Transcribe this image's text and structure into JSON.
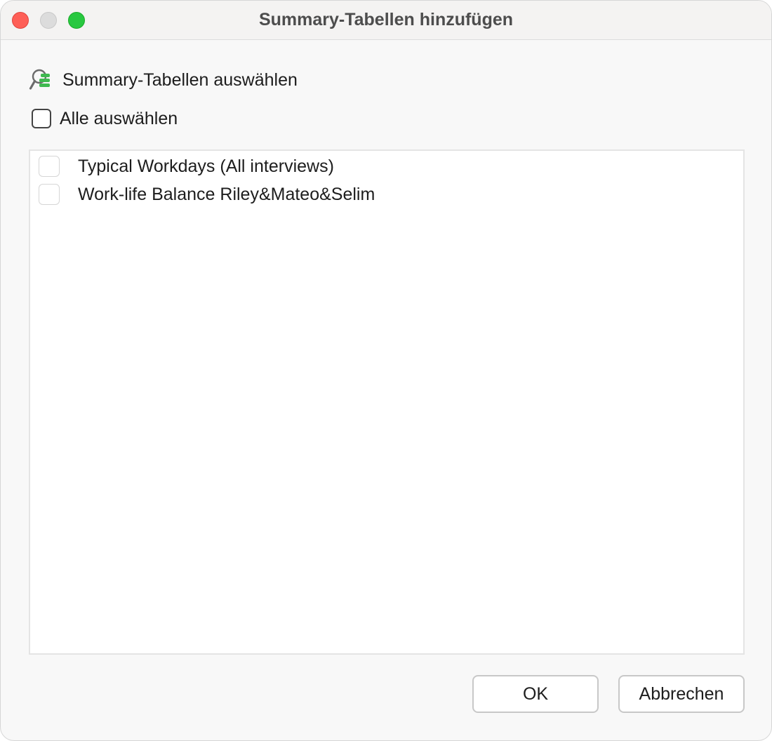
{
  "window": {
    "title": "Summary-Tabellen hinzufügen"
  },
  "section": {
    "label": "Summary-Tabellen auswählen",
    "icon": "summary-table-search-icon"
  },
  "select_all": {
    "label": "Alle auswählen",
    "checked": false
  },
  "list": {
    "items": [
      {
        "label": "Typical Workdays (All interviews)",
        "checked": false
      },
      {
        "label": "Work-life Balance Riley&Mateo&Selim",
        "checked": false
      }
    ]
  },
  "buttons": {
    "ok_label": "OK",
    "cancel_label": "Abbrechen"
  },
  "colors": {
    "close": "#fe5f57",
    "minimize_inactive": "#dcdcdc",
    "maximize": "#28c840",
    "icon_green": "#3fb950",
    "icon_gray": "#6b6b6b"
  }
}
